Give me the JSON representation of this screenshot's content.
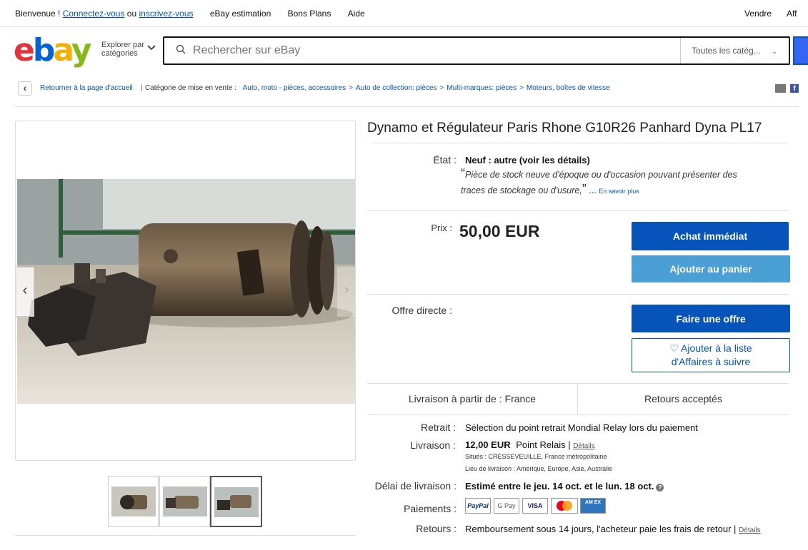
{
  "topbar": {
    "welcome": "Bienvenue !",
    "signin": "Connectez-vous",
    "or": "ou",
    "register": "inscrivez-vous",
    "nav": [
      "eBay estimation",
      "Bons Plans",
      "Aide"
    ],
    "right": [
      "Vendre",
      "Aff"
    ]
  },
  "header": {
    "logo": {
      "e": "e",
      "b": "b",
      "a": "a",
      "y": "y"
    },
    "explore_line1": "Explorer par",
    "explore_line2": "catégories",
    "search_placeholder": "Rechercher sur eBay",
    "category_select": "Toutes les catég...",
    "colors": {
      "brand_blue": "#0654ba",
      "logo_red": "#e53238",
      "logo_blue": "#0064d2",
      "logo_yellow": "#f5af02",
      "logo_green": "#86b817"
    }
  },
  "breadcrumb": {
    "back": "Retourner à la page d'accueil",
    "category_label": "Catégorie de mise en vente :",
    "items": [
      "Auto, moto - pièces, accessoires",
      "Auto de collection: pièces",
      "Multi-marques: pièces",
      "Moteurs, boîtes de vitesse"
    ],
    "separator": ">"
  },
  "item": {
    "title": "Dynamo et Régulateur Paris Rhone G10R26 Panhard Dyna PL17",
    "condition_label": "État :",
    "condition_value": "Neuf : autre (voir les détails)",
    "condition_desc_line1": "Pièce de stock neuve d'époque ou d'occasion pouvant présenter des",
    "condition_desc_line2": "traces de stockage ou d'usure,",
    "quote_open": "“",
    "quote_close": "”",
    "ellipsis": "...",
    "learn_more": "En savoir plus",
    "price_label": "Prix :",
    "price": "50,00 EUR",
    "buy_now": "Achat immédiat",
    "add_to_cart": "Ajouter au panier",
    "offer_label": "Offre directe :",
    "make_offer": "Faire une offre",
    "watch_line1": "♡ Ajouter à la liste",
    "watch_line2": "d'Affaires à suivre"
  },
  "shipping_box": {
    "from": "Livraison à partir de : France",
    "returns": "Retours acceptés"
  },
  "details": {
    "pickup_label": "Retrait :",
    "pickup_value": "Sélection du point retrait Mondial Relay lors du paiement",
    "delivery_label": "Livraison :",
    "delivery_price": "12,00 EUR",
    "delivery_method": "Point Relais |",
    "delivery_details": "Détails",
    "location": "Situés : CRESSEVEUILLE, France métropolitaine",
    "ship_to": "Lieu de livraison : Amérique, Europe, Asie, Australie",
    "delay_label": "Délai de livraison :",
    "delay_value": "Estimé entre le jeu. 14 oct. et le lun. 18 oct.",
    "payments_label": "Paiements :",
    "payments": [
      "PayPal",
      "G Pay",
      "VISA",
      "",
      "AM EX"
    ],
    "returns_label": "Retours :",
    "returns_value": "Remboursement sous 14 jours, l'acheteur paie les frais de retour |",
    "returns_details": "Détails"
  },
  "gallery": {
    "prev": "‹",
    "next": "›"
  }
}
